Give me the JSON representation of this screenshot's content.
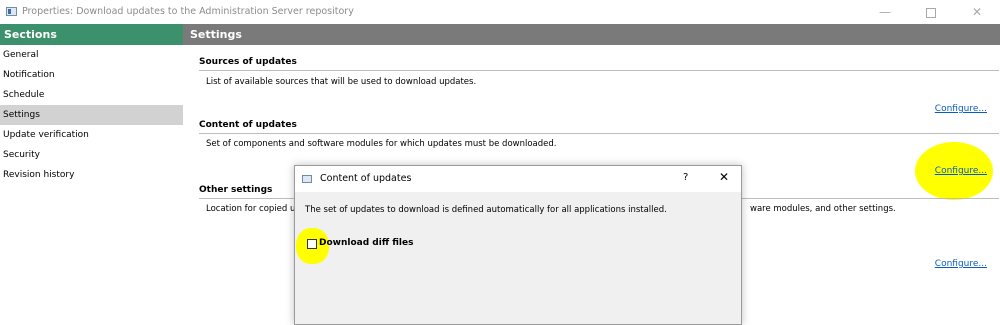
{
  "window": {
    "title": "Properties: Download updates to the Administration Server repository",
    "minimize_glyph": "—",
    "close_glyph": "✕"
  },
  "sidebar": {
    "header": "Sections",
    "items": [
      {
        "label": "General"
      },
      {
        "label": "Notification"
      },
      {
        "label": "Schedule"
      },
      {
        "label": "Settings",
        "active": true
      },
      {
        "label": "Update verification"
      },
      {
        "label": "Security"
      },
      {
        "label": "Revision history"
      }
    ]
  },
  "main": {
    "header": "Settings",
    "sections": [
      {
        "title": "Sources of updates",
        "description": "List of available sources that will be used to download updates.",
        "configure_label": "Configure..."
      },
      {
        "title": "Content of updates",
        "description": "Set of components and software modules for which updates must be downloaded.",
        "configure_label": "Configure..."
      },
      {
        "title": "Other settings",
        "description_start": "Location for copied up",
        "description_end": "ware modules, and other settings.",
        "configure_label": "Configure..."
      }
    ]
  },
  "dialog": {
    "title": "Content of updates",
    "help_glyph": "?",
    "close_glyph": "✕",
    "description": "The set of updates to download is defined automatically for all applications installed.",
    "checkbox_label": "Download diff files",
    "checkbox_checked": false
  },
  "colors": {
    "sidebar_header": "#3c916c",
    "main_header": "#7a7a7a",
    "link": "#0a5bc4",
    "highlight": "#ffff00"
  }
}
